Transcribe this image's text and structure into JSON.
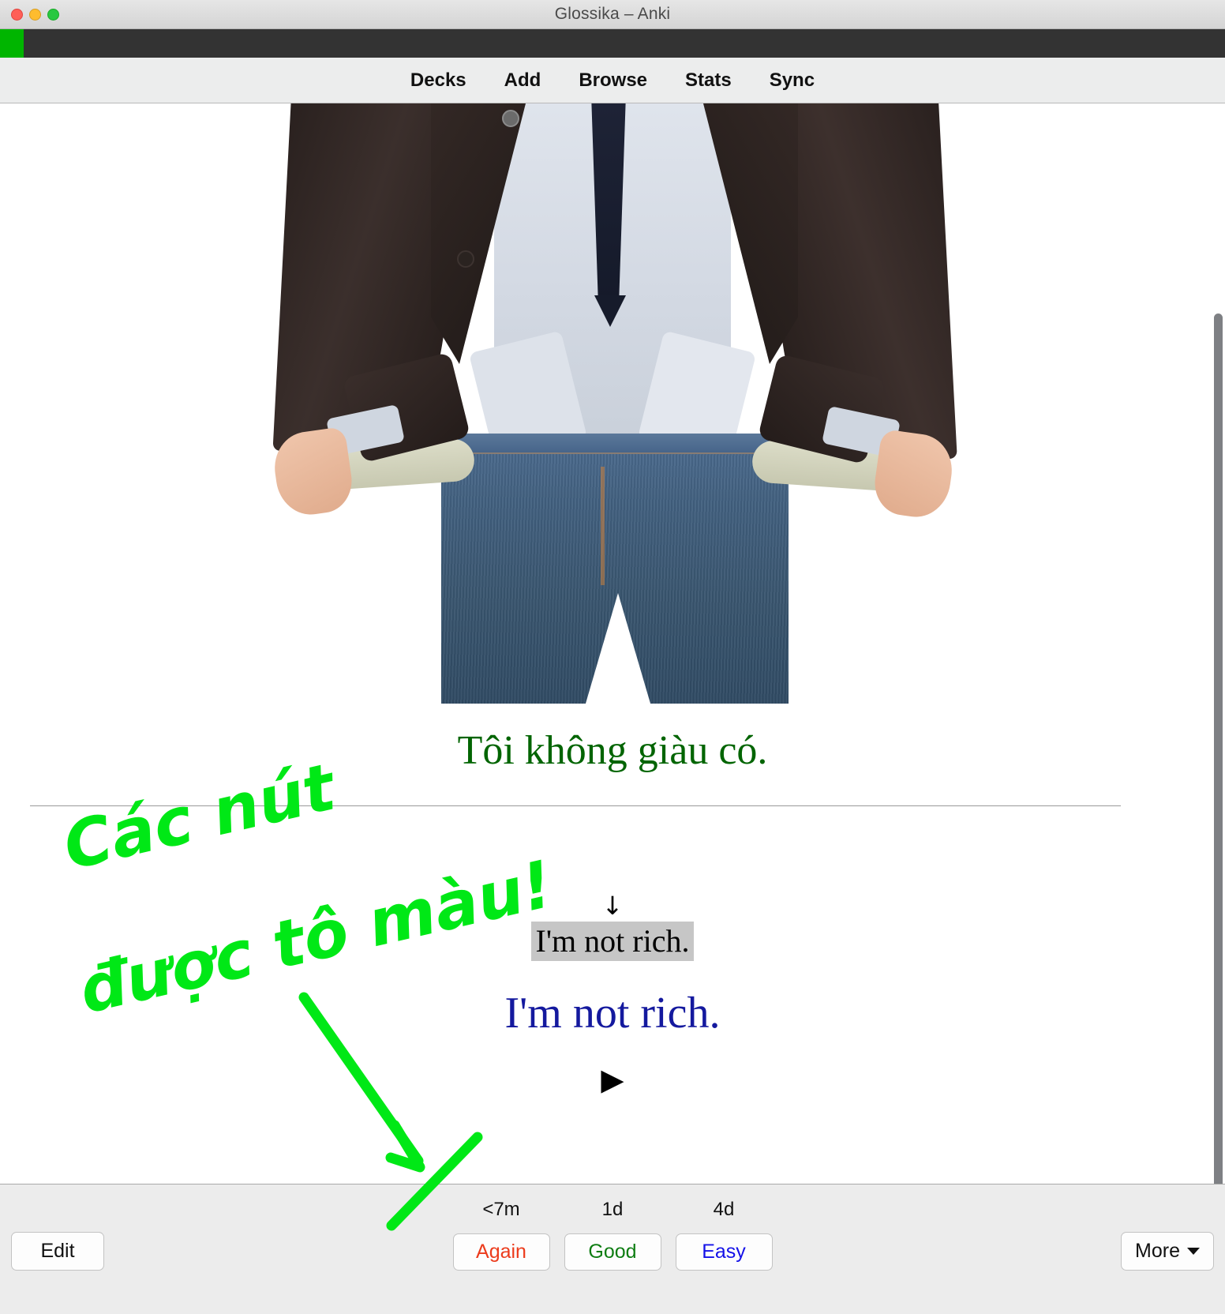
{
  "window": {
    "title": "Glossika – Anki",
    "controls": [
      "close",
      "minimize",
      "maximize"
    ]
  },
  "deck_bar": {
    "progress_color": "#00b500",
    "background_color": "#333333",
    "progress_percent": 2
  },
  "toolbar": {
    "items": [
      {
        "label": "Decks",
        "name": "toolbar-decks"
      },
      {
        "label": "Add",
        "name": "toolbar-add"
      },
      {
        "label": "Browse",
        "name": "toolbar-browse"
      },
      {
        "label": "Stats",
        "name": "toolbar-stats"
      },
      {
        "label": "Sync",
        "name": "toolbar-sync"
      }
    ]
  },
  "card": {
    "image_alt": "man in dark suit pulling out empty trouser pockets",
    "question_text": "Tôi không giàu có.",
    "question_color": "#006400",
    "divider": true,
    "arrow_glyph": "↓",
    "answer_highlight_text": "I'm not rich.",
    "answer_highlight_bg": "#c6c6c6",
    "answer_text": "I'm not rich.",
    "answer_color": "#14199e",
    "play_glyph": "▶"
  },
  "annotation": {
    "color": "#00e816",
    "line1": "Các nút",
    "line2": "được tô màu!",
    "full_text": "Các nút được tô màu!",
    "arrow": "green arrow pointing down to the Again button"
  },
  "answer_bar": {
    "intervals": [
      "<7m",
      "1d",
      "4d"
    ],
    "ease_buttons": [
      {
        "label": "Again",
        "color": "#ec3b1c",
        "name": "again-button"
      },
      {
        "label": "Good",
        "color": "#0e7d12",
        "name": "good-button"
      },
      {
        "label": "Easy",
        "color": "#1411e8",
        "name": "easy-button"
      }
    ],
    "edit_label": "Edit",
    "more_label": "More"
  }
}
